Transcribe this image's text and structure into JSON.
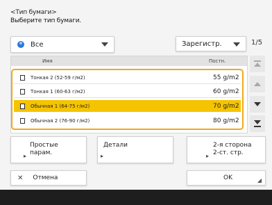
{
  "header": {
    "title": "<Тип бумаги>",
    "instruction": "Выберите тип бумаги."
  },
  "filter": {
    "selected": "Все",
    "icon": "globe-icon"
  },
  "sort": {
    "selected": "Зарегистр."
  },
  "pager": {
    "text": "1/5"
  },
  "columns": {
    "name": "Имя",
    "density": "Постн."
  },
  "rows": [
    {
      "name": "Тонкая 2 (52-59 г/м2)",
      "weight": "55 g/m2",
      "selected": false
    },
    {
      "name": "Тонкая 1 (60-63 г/м2)",
      "weight": "60 g/m2",
      "selected": false
    },
    {
      "name": "Обычная 1 (64-75 г/м2)",
      "weight": "70 g/m2",
      "selected": true
    },
    {
      "name": "Обычная 2 (76-90 г/м2)",
      "weight": "80 g/m2",
      "selected": false
    }
  ],
  "buttons": {
    "simple_line1": "Простые",
    "simple_line2": "парам.",
    "details": "Детали",
    "second_side_line1": "2-я сторона",
    "second_side_line2": "2-ст. стр.",
    "cancel": "Отмена",
    "ok": "OK"
  },
  "colors": {
    "accent": "#f0a91a",
    "selected_row": "#f5c400",
    "bottom_bar": "#1e1e1e"
  }
}
